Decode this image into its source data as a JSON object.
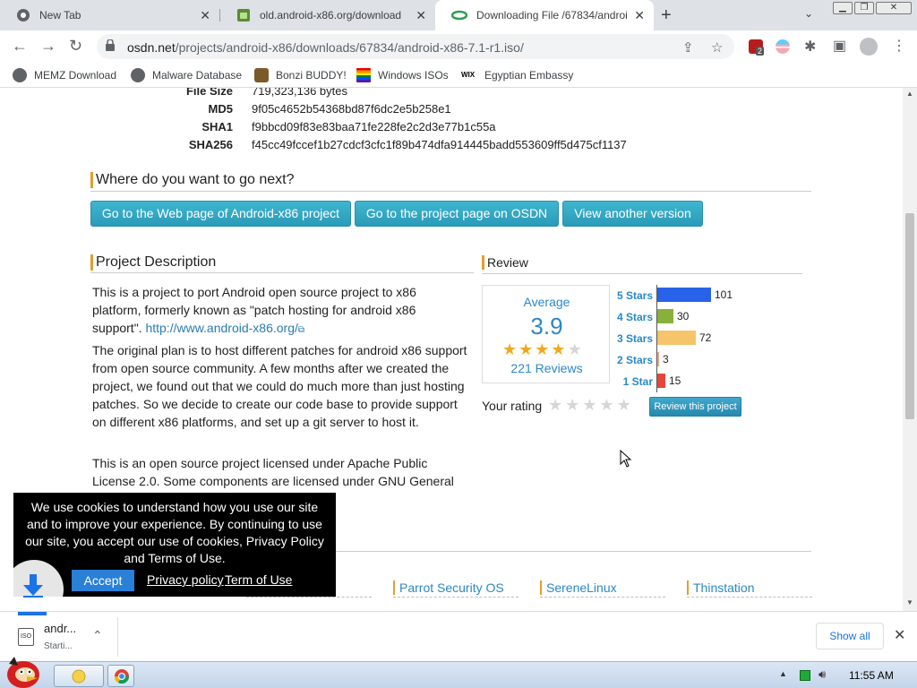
{
  "tabs": [
    {
      "title": "New Tab"
    },
    {
      "title": "old.android-x86.org/download"
    },
    {
      "title": "Downloading File /67834/androi"
    }
  ],
  "address": {
    "host": "osdn.net",
    "path": "/projects/android-x86/downloads/67834/android-x86-7.1-r1.iso/"
  },
  "extension_badge": "2",
  "bookmarks": [
    {
      "label": "MEMZ Download"
    },
    {
      "label": "Malware Database"
    },
    {
      "label": "Bonzi BUDDY!"
    },
    {
      "label": "Windows ISOs"
    },
    {
      "label": "Egyptian Embassy"
    }
  ],
  "file_info": {
    "filesize_label": "File Size",
    "filesize_value": "719,323,136 bytes",
    "md5_label": "MD5",
    "md5_value": "9f05c4652b54368bd87f6dc2e5b258e1",
    "sha1_label": "SHA1",
    "sha1_value": "f9bbcd09f83e83baa71fe228fe2c2d3e77b1c55a",
    "sha256_label": "SHA256",
    "sha256_value": "f45cc49fccef1b27cdcf3cfc1f89b474dfa914445badd553609ff5d475cf1137"
  },
  "next": {
    "heading": "Where do you want to go next?",
    "buttons": [
      "Go to the Web page of Android-x86 project",
      "Go to the project page on OSDN",
      "View another version"
    ]
  },
  "description": {
    "heading": "Project Description",
    "p1": "This is a project to port Android open source project to x86 platform, formerly known as \"patch hosting for android x86 support\".",
    "p1_link": "http://www.android-x86.org/",
    "p2": "The original plan is to host different patches for android x86 support from open source community. A few months after we created the project, we found out that we could do much more than just hosting patches. So we decide to create our code base to provide support on different x86 platforms, and set up a git server to host it.",
    "p3": "This is an open source project licensed under Apache Public License 2.0. Some components are licensed under GNU General"
  },
  "review": {
    "heading": "Review",
    "average_label": "Average",
    "average_value": "3.9",
    "stars_filled": 4,
    "reviews_text": "221 Reviews",
    "rows": [
      {
        "label": "5 Stars",
        "count": 101,
        "color": "#2862e8"
      },
      {
        "label": "4 Stars",
        "count": 30,
        "color": "#88b03b"
      },
      {
        "label": "3 Stars",
        "count": 72,
        "color": "#f5c46b"
      },
      {
        "label": "2 Stars",
        "count": 3,
        "color": "#f0a38a"
      },
      {
        "label": "1 Star",
        "count": 15,
        "color": "#e8443a"
      }
    ],
    "your_rating_label": "Your rating",
    "review_button": "Review this project"
  },
  "related": [
    "Parrot Security OS",
    "SereneLinux",
    "Thinstation"
  ],
  "cookie": {
    "text": "We use cookies to understand how you use our site and to improve your experience. By continuing to use our site, you accept our use of cookies, Privacy Policy and Terms of Use.",
    "accept": "Accept",
    "privacy_link": "Privacy policy",
    "terms_link": "Term of Use"
  },
  "download_shelf": {
    "filename": "andr...",
    "status": "Starti...",
    "show_all": "Show all"
  },
  "taskbar": {
    "clock": "11:55 AM"
  }
}
